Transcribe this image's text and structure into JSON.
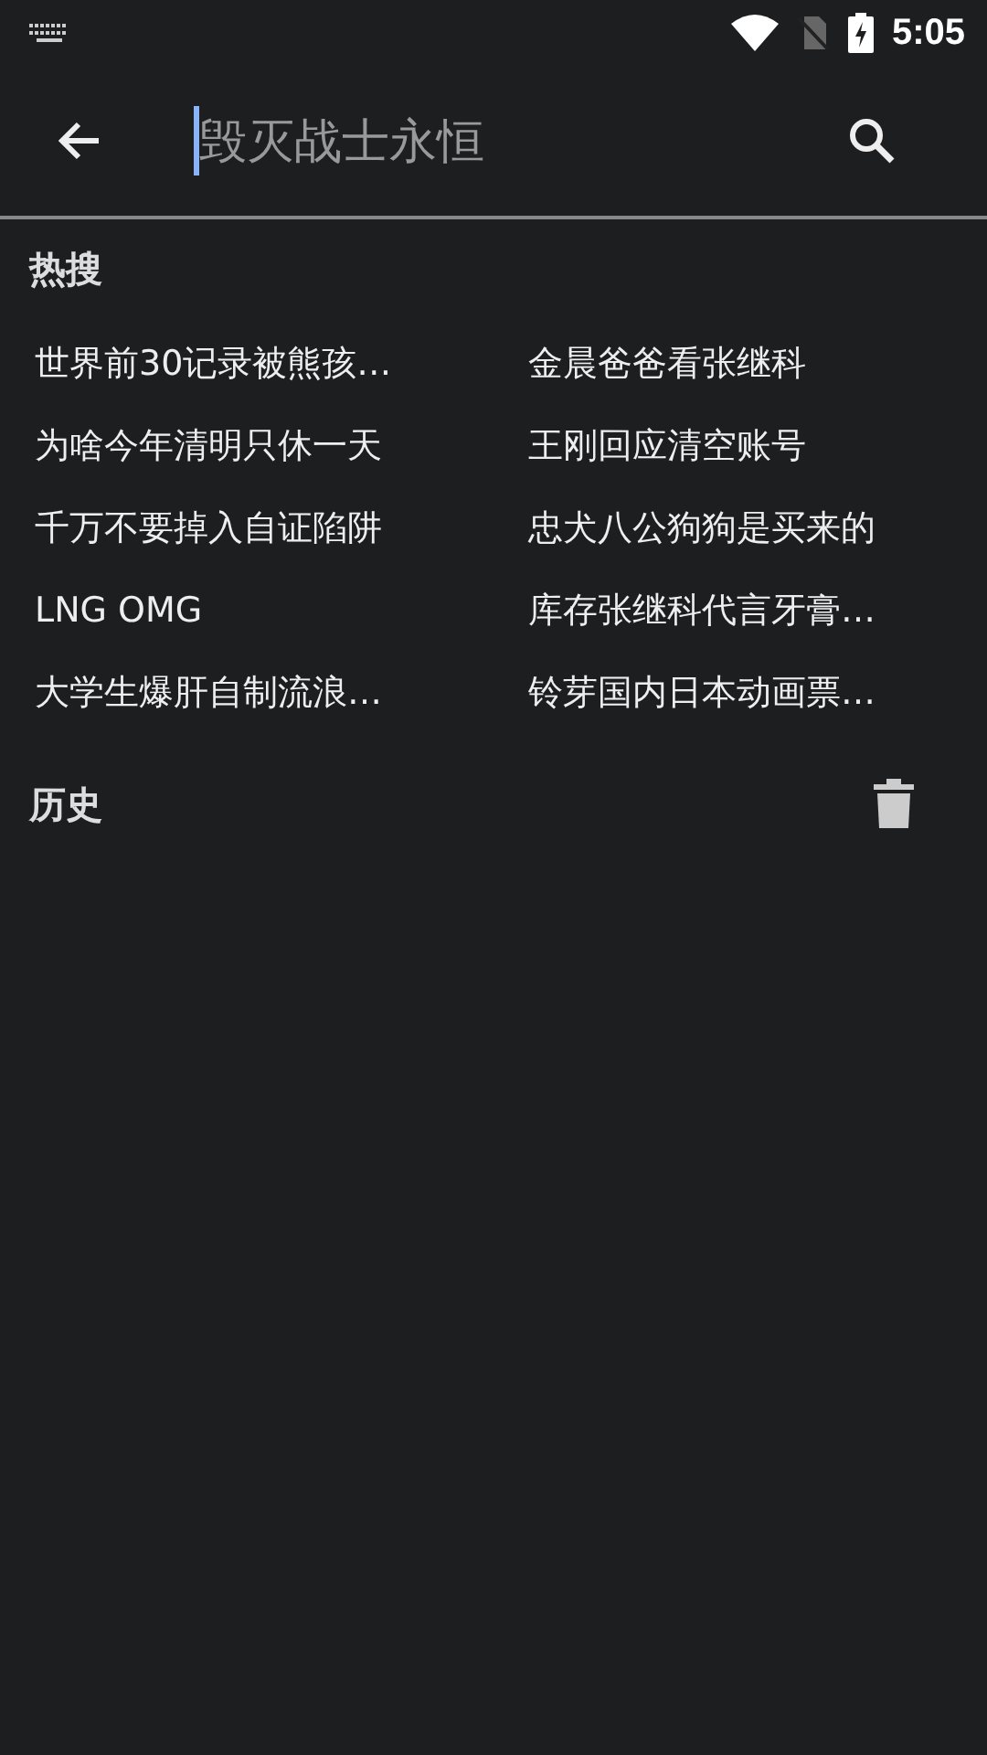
{
  "status_bar": {
    "time": "5:05"
  },
  "search": {
    "placeholder": "毁灭战士永恒"
  },
  "hot": {
    "title": "热搜",
    "items": [
      "世界前30记录被熊孩…",
      "金晨爸爸看张继科",
      "为啥今年清明只休一天",
      "王刚回应清空账号",
      "千万不要掉入自证陷阱",
      "忠犬八公狗狗是买来的",
      "LNG OMG",
      "库存张继科代言牙膏…",
      "大学生爆肝自制流浪…",
      "铃芽国内日本动画票…"
    ]
  },
  "history": {
    "title": "历史"
  }
}
